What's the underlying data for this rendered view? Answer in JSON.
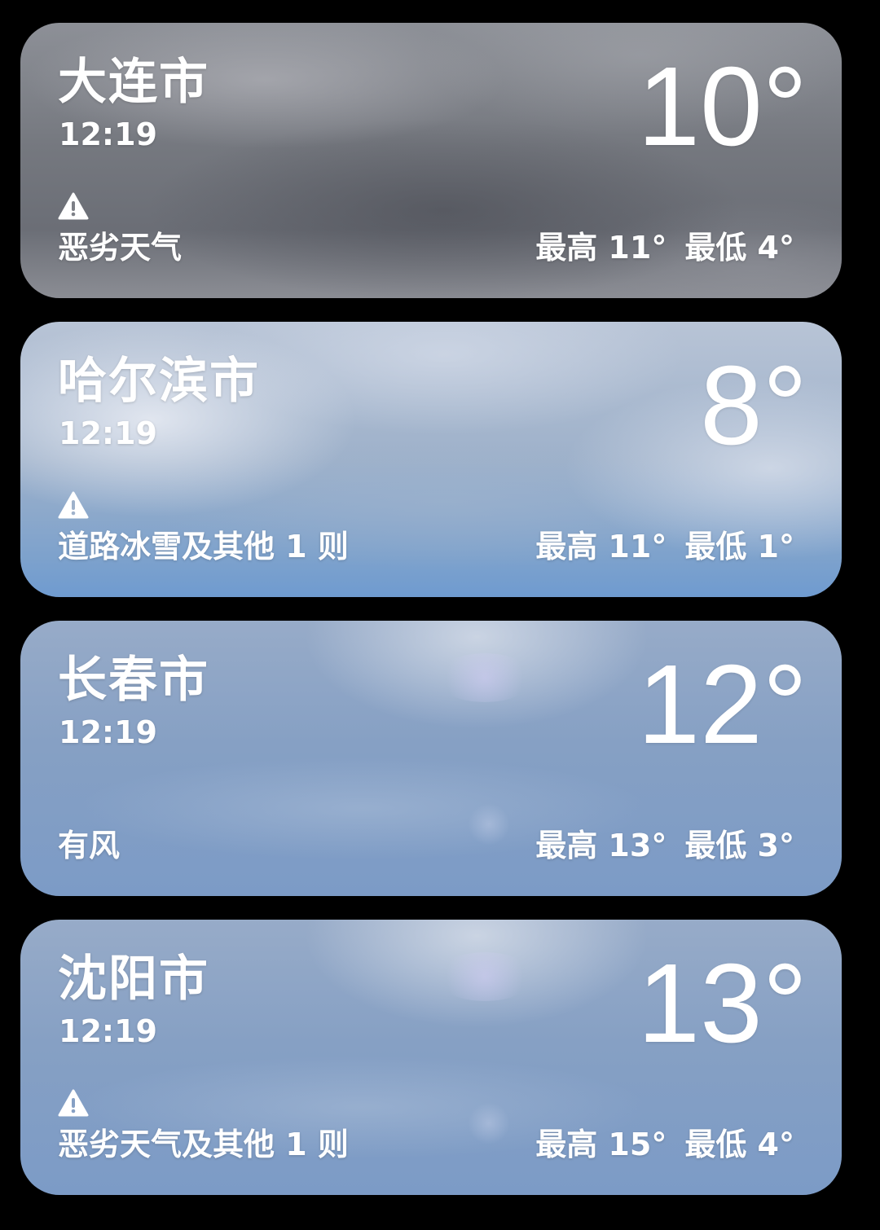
{
  "cards": [
    {
      "city": "大连市",
      "time": "12:19",
      "temp": "10°",
      "has_alert": true,
      "alert_icon": "warning-triangle-icon",
      "condition": "恶劣天气",
      "high": "最高 11°",
      "low": "最低 4°"
    },
    {
      "city": "哈尔滨市",
      "time": "12:19",
      "temp": "8°",
      "has_alert": true,
      "alert_icon": "warning-triangle-icon",
      "condition": "道路冰雪及其他 1 则",
      "high": "最高 11°",
      "low": "最低 1°"
    },
    {
      "city": "长春市",
      "time": "12:19",
      "temp": "12°",
      "has_alert": false,
      "condition": "有风",
      "high": "最高 13°",
      "low": "最低 3°"
    },
    {
      "city": "沈阳市",
      "time": "12:19",
      "temp": "13°",
      "has_alert": true,
      "alert_icon": "warning-triangle-icon",
      "condition": "恶劣天气及其他 1 则",
      "high": "最高 15°",
      "low": "最低 4°"
    }
  ],
  "colors": {
    "background": "#000000",
    "text": "#ffffff"
  }
}
